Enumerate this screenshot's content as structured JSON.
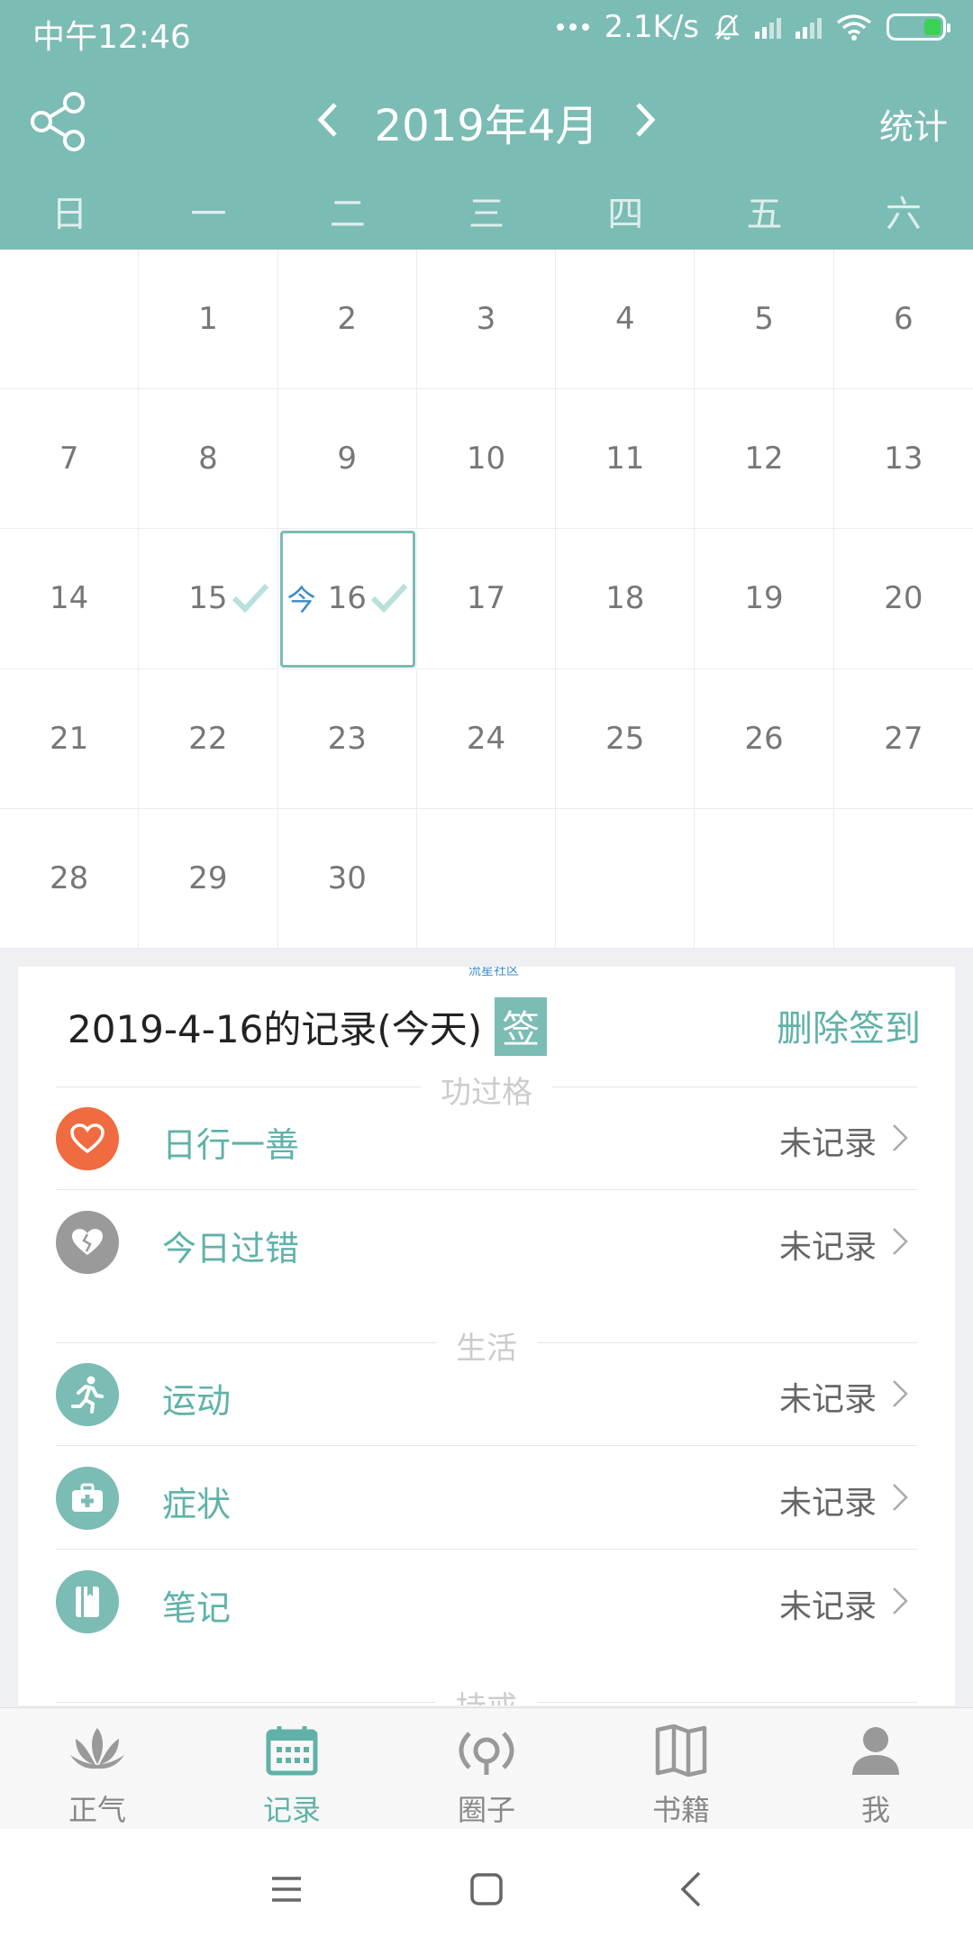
{
  "status_bar": {
    "time": "中午12:46",
    "network_speed": "2.1K/s"
  },
  "header": {
    "month_title": "2019年4月",
    "stats_label": "统计"
  },
  "weekdays": [
    "日",
    "一",
    "二",
    "三",
    "四",
    "五",
    "六"
  ],
  "calendar": {
    "cells": [
      "",
      "1",
      "2",
      "3",
      "4",
      "5",
      "6",
      "7",
      "8",
      "9",
      "10",
      "11",
      "12",
      "13",
      "14",
      "15",
      "16",
      "17",
      "18",
      "19",
      "20",
      "21",
      "22",
      "23",
      "24",
      "25",
      "26",
      "27",
      "28",
      "29",
      "30",
      "",
      "",
      "",
      ""
    ],
    "today_tag": "今",
    "today": "16",
    "checked_days": [
      "15",
      "16"
    ]
  },
  "record": {
    "watermark": "流星社区",
    "heading": "2019-4-16的记录(今天)",
    "sign_badge": "签",
    "delete_label": "删除签到",
    "sections": {
      "merit": "功过格",
      "life": "生活",
      "precepts": "持戒"
    },
    "items": [
      {
        "label": "日行一善",
        "status": "未记录",
        "icon": "heart-icon",
        "color": "#f06b40"
      },
      {
        "label": "今日过错",
        "status": "未记录",
        "icon": "broken-heart-icon",
        "color": "#9a9a9a"
      },
      {
        "label": "运动",
        "status": "未记录",
        "icon": "running-icon",
        "color": "#7bbcb4"
      },
      {
        "label": "症状",
        "status": "未记录",
        "icon": "medical-kit-icon",
        "color": "#7bbcb4"
      },
      {
        "label": "笔记",
        "status": "未记录",
        "icon": "notebook-icon",
        "color": "#7bbcb4"
      }
    ]
  },
  "tabs": [
    {
      "label": "正气",
      "icon": "lotus-icon"
    },
    {
      "label": "记录",
      "icon": "calendar-icon",
      "active": true
    },
    {
      "label": "圈子",
      "icon": "broadcast-icon"
    },
    {
      "label": "书籍",
      "icon": "book-icon"
    },
    {
      "label": "我",
      "icon": "user-icon"
    }
  ],
  "colors": {
    "accent": "#7bbcb4",
    "accent_text": "#5fb2a8",
    "today_tag": "#3a8bc7"
  }
}
